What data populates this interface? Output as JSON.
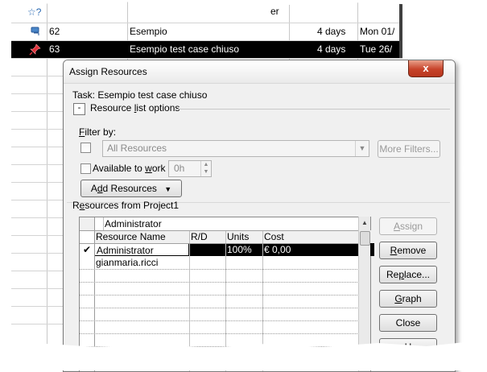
{
  "sheet": {
    "header_fragment": "er",
    "rows": [
      {
        "id": "62",
        "name": "Esempio",
        "duration": "4 days",
        "start": "Mon 01/",
        "selected": false,
        "icon": "task-info-icon"
      },
      {
        "id": "63",
        "name": "Esempio test case chiuso",
        "duration": "4 days",
        "start": "Tue 26/",
        "selected": true,
        "icon": "pin-icon"
      }
    ]
  },
  "dialog": {
    "title": "Assign Resources",
    "close_label": "x",
    "task_label": "Task: Esempio test case chiuso",
    "collapse_symbol": "-",
    "options_label_pre": "Resource ",
    "options_label_key": "l",
    "options_label_post": "ist options",
    "filter_label_pre": "",
    "filter_label_key": "F",
    "filter_label_post": "ilter by:",
    "filter_value": "All Resources",
    "more_filters": "More Filters...",
    "available_pre": "Available to ",
    "available_key": "w",
    "available_post": "ork",
    "available_value": "0h",
    "add_resources_pre": "A",
    "add_resources_key": "d",
    "add_resources_post": "d Resources",
    "resources_from_pre": "R",
    "resources_from_key": "e",
    "resources_from_post": "sources from Project1",
    "edit_value": "Administrator",
    "columns": [
      "Resource Name",
      "R/D",
      "Units",
      "Cost"
    ],
    "resources": [
      {
        "check": "✔",
        "name": "Administrator",
        "rd": "",
        "units": "100%",
        "cost": "€ 0,00"
      },
      {
        "check": "",
        "name": "gianmaria.ricci",
        "rd": "",
        "units": "",
        "cost": ""
      }
    ],
    "buttons": {
      "assign": {
        "pre": "",
        "key": "A",
        "post": "ssign"
      },
      "remove": {
        "pre": "",
        "key": "R",
        "post": "emove"
      },
      "replace": {
        "pre": "Re",
        "key": "p",
        "post": "lace..."
      },
      "graph": {
        "pre": "",
        "key": "G",
        "post": "raph"
      },
      "close": {
        "pre": "",
        "key": "",
        "post": "Close"
      },
      "help": {
        "pre": "",
        "key": "H",
        "post": ""
      }
    }
  }
}
